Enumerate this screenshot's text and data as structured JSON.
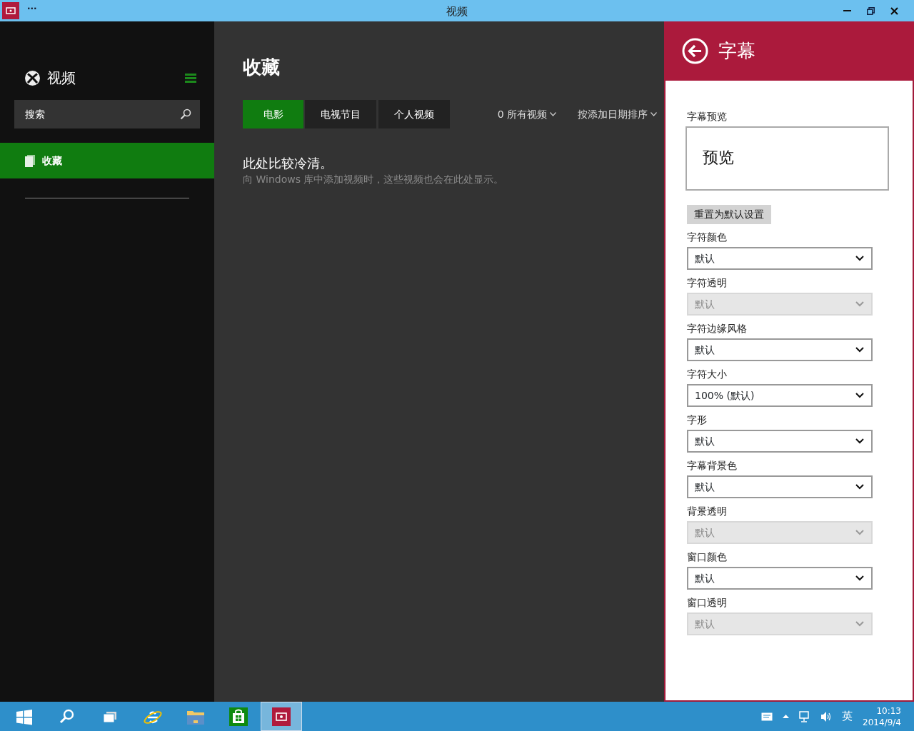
{
  "window": {
    "title": "视频",
    "menu": "···"
  },
  "sidebar": {
    "app_name": "视频",
    "search": {
      "placeholder": "搜索"
    },
    "items": [
      {
        "label": "收藏",
        "selected": true
      }
    ]
  },
  "main": {
    "title": "收藏",
    "tabs": [
      {
        "label": "电影",
        "selected": true
      },
      {
        "label": "电视节目",
        "selected": false
      },
      {
        "label": "个人视频",
        "selected": false
      }
    ],
    "filters": [
      "0 所有视频",
      "按添加日期排序"
    ],
    "empty_title": "此处比较冷清。",
    "empty_text": "向 Windows 库中添加视频时，这些视频也会在此处显示。"
  },
  "settings": {
    "title": "字幕",
    "preview_label": "字幕预览",
    "preview_text": "预览",
    "reset_button": "重置为默认设置",
    "fields": [
      {
        "label": "字符颜色",
        "value": "默认",
        "disabled": false
      },
      {
        "label": "字符透明",
        "value": "默认",
        "disabled": true
      },
      {
        "label": "字符边缘风格",
        "value": "默认",
        "disabled": false
      },
      {
        "label": "字符大小",
        "value": "100% (默认)",
        "disabled": false
      },
      {
        "label": "字形",
        "value": "默认",
        "disabled": false
      },
      {
        "label": "字幕背景色",
        "value": "默认",
        "disabled": false
      },
      {
        "label": "背景透明",
        "value": "默认",
        "disabled": true
      },
      {
        "label": "窗口颜色",
        "value": "默认",
        "disabled": false
      },
      {
        "label": "窗口透明",
        "value": "默认",
        "disabled": true
      }
    ]
  },
  "taskbar": {
    "apps": [
      {
        "kind": "start",
        "selected": false
      },
      {
        "kind": "search",
        "selected": false
      },
      {
        "kind": "taskview",
        "selected": false
      },
      {
        "kind": "ie",
        "selected": false
      },
      {
        "kind": "explorer",
        "selected": false
      },
      {
        "kind": "store",
        "selected": false
      },
      {
        "kind": "video",
        "selected": true
      }
    ],
    "language": "英",
    "time": "10:13",
    "date": "2014/9/4"
  }
}
